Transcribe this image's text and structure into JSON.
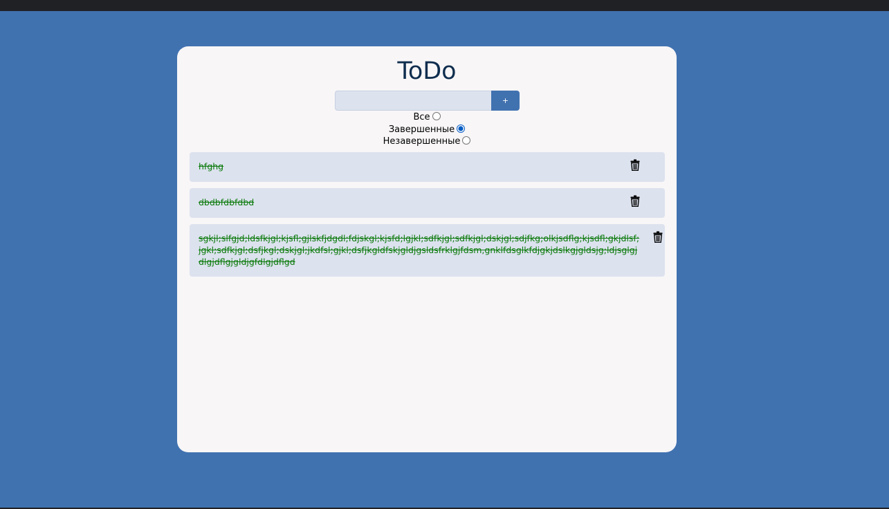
{
  "app": {
    "title": "ToDo"
  },
  "form": {
    "input_value": "",
    "input_placeholder": "",
    "add_label": "+"
  },
  "filters": {
    "options": [
      {
        "label": "Все",
        "checked": false
      },
      {
        "label": "Завершенные",
        "checked": true
      },
      {
        "label": "Незавершенные",
        "checked": false
      }
    ]
  },
  "todos": [
    {
      "text": "hfghg",
      "completed": true
    },
    {
      "text": "dbdbfdbfdbd",
      "completed": true
    },
    {
      "text": "sgkjl;slfgjd;ldsfkjgl;kjsfl;gjlskfjdgdl;fdjskgl;kjsfd;lgjkl;sdfkjgl;sdfkjgl;dskjgl;sdjfkg;olkjsdflg;kjsdfl;gkjdlsf;jgkl;sdfkjgl;dsfjkgl;dskjgl;jkdfsl;gjkl;dsfjkgldfskjgldjgsldsfrklgjfdsm,gnklfdsglkfdjgkjdslkgjgldsjg;ldjsglgjdlgjdflgjgldjgfdlgjdflgd",
      "completed": true
    }
  ],
  "icons": {
    "delete": "trash-icon"
  },
  "colors": {
    "background": "#4172b0",
    "card": "#f8f6f7",
    "item_background": "#dce2ee",
    "completed_text": "#0b7a0b",
    "title": "#0f2d4e"
  }
}
